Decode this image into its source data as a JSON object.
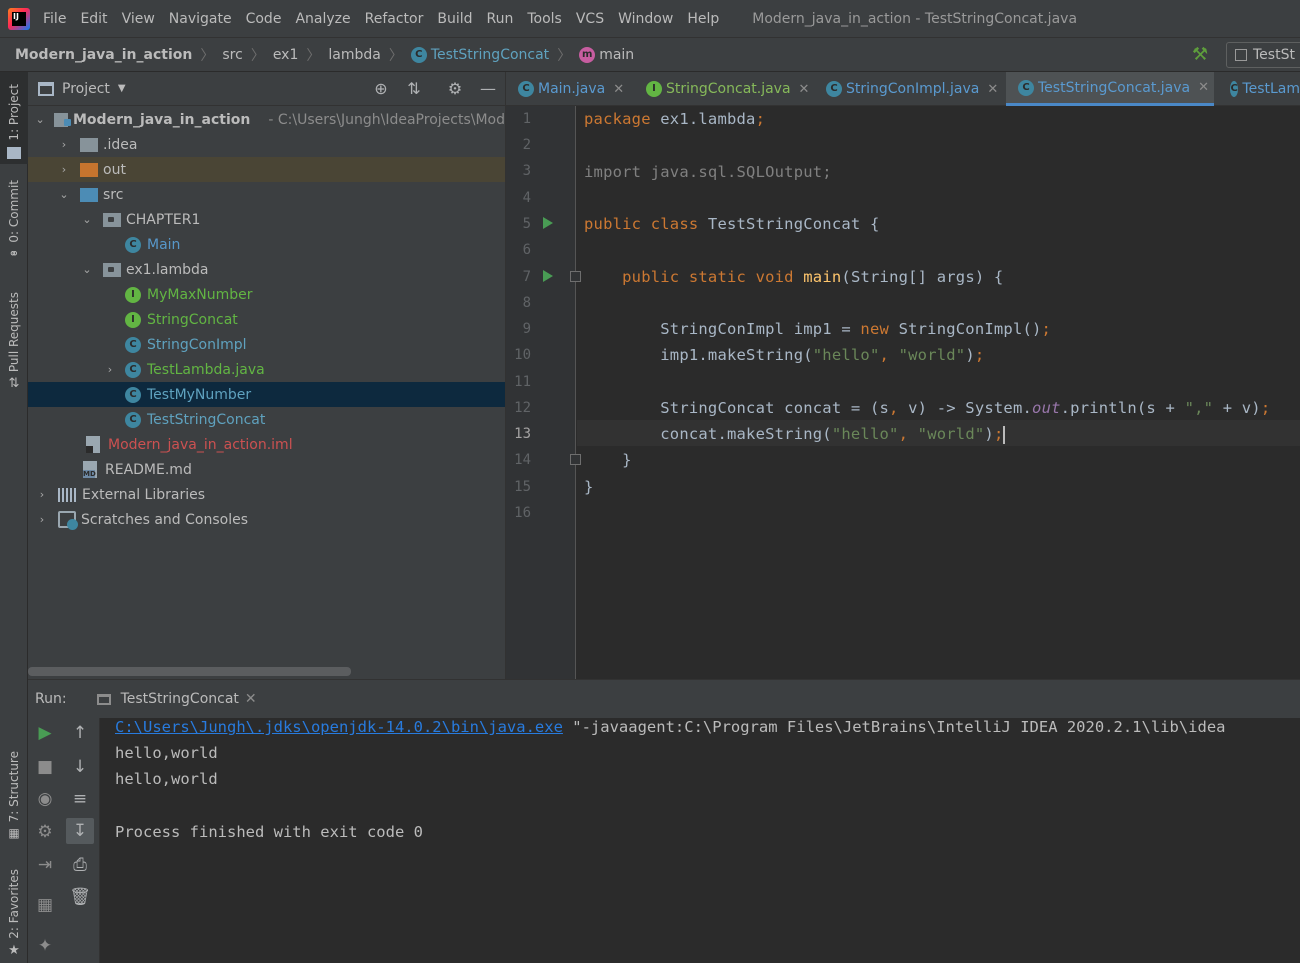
{
  "menu": {
    "items": [
      "File",
      "Edit",
      "View",
      "Navigate",
      "Code",
      "Analyze",
      "Refactor",
      "Build",
      "Run",
      "Tools",
      "VCS",
      "Window",
      "Help"
    ],
    "window_title": "Modern_java_in_action - TestStringConcat.java"
  },
  "breadcrumb": {
    "project": "Modern_java_in_action",
    "src": "src",
    "pkg1": "ex1",
    "pkg2": "lambda",
    "class": "TestStringConcat",
    "method": "main"
  },
  "run_config": {
    "label": "TestSt"
  },
  "left_strip": {
    "project": "1: Project",
    "commit": "0: Commit",
    "pull_requests": "Pull Requests",
    "structure": "7: Structure",
    "favorites": "2: Favorites"
  },
  "project_panel": {
    "title": "Project",
    "tree": {
      "root_name": "Modern_java_in_action",
      "root_path": "- C:\\Users\\Jungh\\IdeaProjects\\Mod",
      "idea": ".idea",
      "out": "out",
      "src": "src",
      "chapter1": "CHAPTER1",
      "main": "Main",
      "ex1lambda": "ex1.lambda",
      "mymaxnumber": "MyMaxNumber",
      "stringconcat": "StringConcat",
      "stringconimpl": "StringConImpl",
      "testlambda": "TestLambda.java",
      "testmynumber": "TestMyNumber",
      "teststringconcat": "TestStringConcat",
      "iml": "Modern_java_in_action.iml",
      "readme": "README.md",
      "extlibs": "External Libraries",
      "scratches": "Scratches and Consoles"
    }
  },
  "editor": {
    "tabs": [
      "Main.java",
      "StringConcat.java",
      "StringConImpl.java",
      "TestStringConcat.java",
      "TestLam"
    ],
    "line_numbers": [
      "1",
      "2",
      "3",
      "4",
      "5",
      "6",
      "7",
      "8",
      "9",
      "10",
      "11",
      "12",
      "13",
      "14",
      "15",
      "16"
    ],
    "current_line": 13
  },
  "run_panel": {
    "label": "Run:",
    "tab": "TestStringConcat",
    "console": {
      "cmd_link": "C:\\Users\\Jungh\\.jdks\\openjdk-14.0.2\\bin\\java.exe",
      "cmd_rest": " \"-javaagent:C:\\Program Files\\JetBrains\\IntelliJ IDEA 2020.2.1\\lib\\idea",
      "out1": "hello,world",
      "out2": "hello,world",
      "exit": "Process finished with exit code 0"
    }
  },
  "colors": {
    "keyword": "#cc7832",
    "string": "#6a8759",
    "method_decl": "#ffc66d",
    "static_field": "#9876aa",
    "link": "#287bde",
    "selection": "#0d293e"
  }
}
